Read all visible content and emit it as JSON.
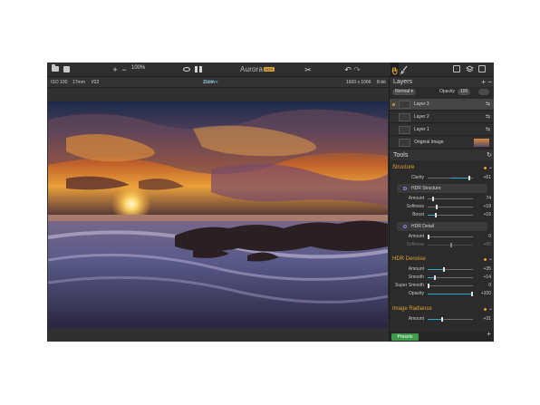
{
  "toolbar": {
    "open_icon": "folder-icon",
    "store_icon": "bag-icon",
    "zoom_in": "+",
    "zoom_out": "−",
    "zoom_value": "100%",
    "logo_text": "Aurora",
    "logo_badge": "HDR",
    "undo": "↶",
    "redo": "↷",
    "crop": "✂"
  },
  "infobar": {
    "iso": "ISO 100",
    "focal": "17mm",
    "aperture": "f/22",
    "zoom_label": "Zoom:",
    "zoom_value": "121% ▾",
    "dimensions": "1600 x 1066",
    "bitdepth": "8-bit"
  },
  "layers": {
    "title": "Layers",
    "blend_mode": "Normal ▾",
    "opacity_label": "Opacity",
    "opacity_value": "100",
    "items": [
      {
        "name": "Layer 3",
        "selected": true
      },
      {
        "name": "Layer 2",
        "selected": false
      },
      {
        "name": "Layer 1",
        "selected": false
      },
      {
        "name": "Original Image",
        "selected": false
      }
    ]
  },
  "tools": {
    "title": "Tools",
    "sections": [
      {
        "name": "Structure",
        "rows": [
          {
            "label": "Clarity",
            "value": "+61",
            "pos": 0.8
          }
        ],
        "sub": {
          "name": "HDR Structure",
          "rows": [
            {
              "label": "Amount",
              "value": "74",
              "pos": 0.1
            },
            {
              "label": "Softness",
              "value": "+18",
              "pos": 0.18
            },
            {
              "label": "Boost",
              "value": "+16",
              "pos": 0.16
            }
          ]
        },
        "sub2": {
          "name": "HDR Detail",
          "rows": [
            {
              "label": "Amount",
              "value": "0",
              "pos": 0.0
            },
            {
              "label": "Softness",
              "value": "+50",
              "pos": 0.5
            }
          ]
        }
      },
      {
        "name": "HDR Denoise",
        "rows": [
          {
            "label": "Amount",
            "value": "+35",
            "pos": 0.35
          },
          {
            "label": "Smooth",
            "value": "+14",
            "pos": 0.14
          },
          {
            "label": "Super Smooth",
            "value": "0",
            "pos": 0.0
          },
          {
            "label": "Opacity",
            "value": "+100",
            "pos": 1.0
          }
        ]
      },
      {
        "name": "Image Radiance",
        "rows": [
          {
            "label": "Amount",
            "value": "+31",
            "pos": 0.31
          }
        ]
      }
    ],
    "presets_label": "Presets"
  },
  "colors": {
    "accent_orange": "#e0a032",
    "slider_fill": "#3aa4c4",
    "presets_green": "#3f9a4d",
    "zoom_blue": "#35a9d9"
  }
}
